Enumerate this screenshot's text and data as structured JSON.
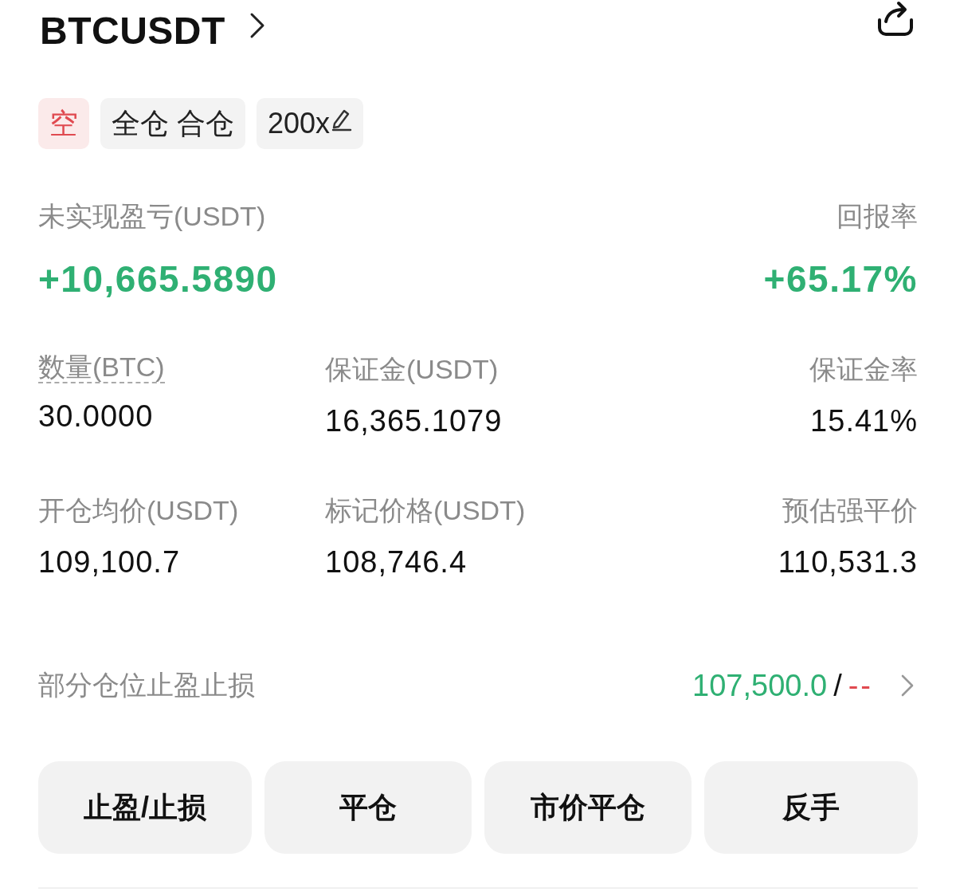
{
  "header": {
    "symbol": "BTCUSDT"
  },
  "tags": [
    {
      "kind": "side",
      "label": "空"
    },
    {
      "kind": "mode",
      "label": "全仓 合仓"
    },
    {
      "kind": "leverage",
      "label": "200x"
    }
  ],
  "pnl": {
    "label": "未实现盈亏(USDT)",
    "value": "+10,665.5890",
    "roe_label": "回报率",
    "roe_value": "+65.17%"
  },
  "stats": [
    {
      "label": "数量(BTC)",
      "value": "30.0000",
      "underlined": true
    },
    {
      "label": "保证金(USDT)",
      "value": "16,365.1079",
      "underlined": false
    },
    {
      "label": "保证金率",
      "value": "15.41%",
      "underlined": false
    },
    {
      "label": "开仓均价(USDT)",
      "value": "109,100.7",
      "underlined": false
    },
    {
      "label": "标记价格(USDT)",
      "value": "108,746.4",
      "underlined": false
    },
    {
      "label": "预估强平价",
      "value": "110,531.3",
      "underlined": false
    }
  ],
  "tpsl": {
    "label": "部分仓位止盈止损",
    "take_profit": "107,500.0",
    "separator": "/",
    "stop_loss": "--"
  },
  "buttons": [
    "止盈/止损",
    "平仓",
    "市价平仓",
    "反手"
  ]
}
